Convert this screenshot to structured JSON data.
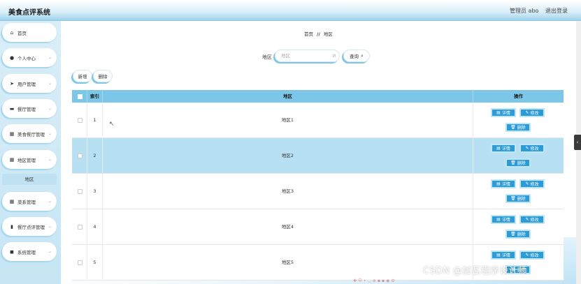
{
  "header": {
    "app_title": "美食点评系统",
    "admin_label": "管理员 abo",
    "logout_label": "退出登录"
  },
  "sidebar": {
    "items": [
      {
        "label": "首页",
        "icon": "home-icon",
        "glyph": "⌂",
        "has_arrow": false
      },
      {
        "label": "个人中心",
        "icon": "user-icon",
        "glyph": "●",
        "has_arrow": true
      },
      {
        "label": "用户管理",
        "icon": "send-icon",
        "glyph": "➤",
        "has_arrow": true
      },
      {
        "label": "餐厅管理",
        "icon": "card-icon",
        "glyph": "▬",
        "has_arrow": true
      },
      {
        "label": "美食餐厅管理",
        "icon": "grid-icon",
        "glyph": "▦",
        "has_arrow": true
      },
      {
        "label": "地区管理",
        "icon": "grid-icon",
        "glyph": "▦",
        "has_arrow": true
      },
      {
        "label": "菜系管理",
        "icon": "grid-icon",
        "glyph": "▦",
        "has_arrow": true
      },
      {
        "label": "餐厅点评管理",
        "icon": "chart-icon",
        "glyph": "▮",
        "has_arrow": true
      },
      {
        "label": "系统管理",
        "icon": "folder-icon",
        "glyph": "◼",
        "has_arrow": true
      }
    ],
    "sub_item": "地区"
  },
  "breadcrumb": {
    "home": "首页",
    "sep": "//",
    "current": "地区"
  },
  "search": {
    "label": "地区",
    "placeholder": "地区",
    "value": "",
    "query_label": "查询"
  },
  "actions": {
    "add_label": "新增",
    "delete_label": "删除"
  },
  "table": {
    "headers": {
      "index": "索引",
      "region": "地区",
      "operation": "操作"
    },
    "rows": [
      {
        "index": "1",
        "region": "地区1"
      },
      {
        "index": "2",
        "region": "地区2"
      },
      {
        "index": "3",
        "region": "地区3"
      },
      {
        "index": "4",
        "region": "地区4"
      },
      {
        "index": "5",
        "region": "地区5"
      }
    ],
    "op_labels": {
      "detail": "详情",
      "edit": "修改",
      "delete": "删除"
    }
  },
  "watermark": "CSDN @加瓦程序设计师",
  "colors": {
    "accent": "#2d9bd6",
    "header_row": "#7cc6e8",
    "selected_row": "#b7e0f2"
  }
}
